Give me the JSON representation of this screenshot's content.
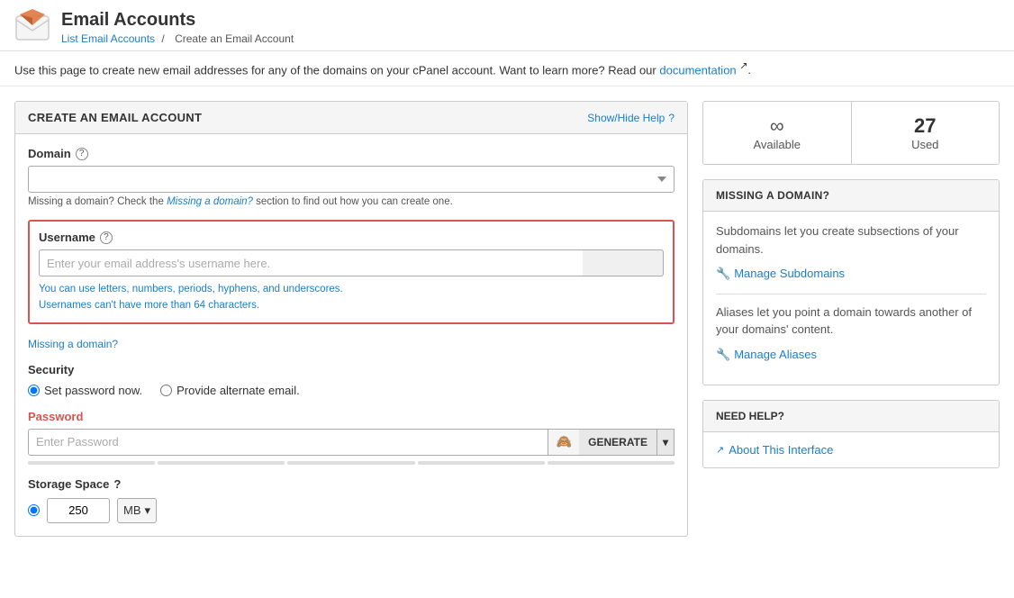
{
  "page": {
    "title": "Email Accounts",
    "breadcrumb_home": "List Email Accounts",
    "breadcrumb_current": "Create an Email Account",
    "description": "Use this page to create new email addresses for any of the domains on your cPanel account. Want to learn more? Read our",
    "doc_link_text": "documentation",
    "doc_link_icon": "↗"
  },
  "form": {
    "card_title": "CREATE AN EMAIL ACCOUNT",
    "show_hide_help": "Show/Hide Help",
    "domain_label": "Domain",
    "domain_placeholder": "",
    "domain_hint": "Missing a domain? Check the",
    "domain_hint_link": "Missing a domain?",
    "domain_hint_suffix": "section to find out how you can create one.",
    "username_label": "Username",
    "username_placeholder": "Enter your email address's username here.",
    "username_hint1": "You can use letters, numbers, periods, hyphens, and underscores.",
    "username_hint2": "Usernames can't have more than 64 characters.",
    "missing_domain_link": "Missing a domain?",
    "security_label": "Security",
    "radio_set_password": "Set password now.",
    "radio_alternate_email": "Provide alternate email.",
    "password_label": "Password",
    "password_placeholder": "Enter Password",
    "btn_generate": "GENERATE",
    "storage_label": "Storage Space",
    "storage_value": "250",
    "storage_unit": "MB"
  },
  "sidebar": {
    "available_label": "Available",
    "used_label": "Used",
    "used_count": "27",
    "missing_domain_header": "MISSING A DOMAIN?",
    "missing_domain_text1": "Subdomains let you create subsections of your domains.",
    "manage_subdomains": "Manage Subdomains",
    "missing_domain_text2": "Aliases let you point a domain towards another of your domains' content.",
    "manage_aliases": "Manage Aliases",
    "need_help_header": "NEED HELP?",
    "about_interface": "About This Interface"
  },
  "icons": {
    "help": "?",
    "chevron_down": "▾",
    "eye_slash": "👁",
    "wrench": "🔧",
    "external_link": "↗"
  }
}
